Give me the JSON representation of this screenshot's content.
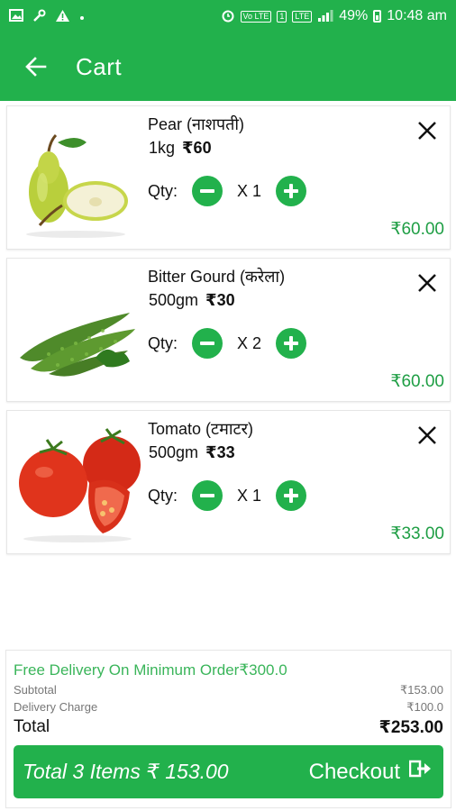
{
  "status_bar": {
    "volte": "Vo LTE",
    "sim": "1",
    "lte": "LTE",
    "battery": "49%",
    "time": "10:48 am"
  },
  "app_bar": {
    "title": "Cart"
  },
  "qty_label": "Qty:",
  "items": [
    {
      "name": "Pear (नाशपती)",
      "unit": "1kg",
      "price": "₹60",
      "qty": "X 1",
      "subtotal": "₹60.00"
    },
    {
      "name": "Bitter Gourd (करेला)",
      "unit": "500gm",
      "price": "₹30",
      "qty": "X 2",
      "subtotal": "₹60.00"
    },
    {
      "name": "Tomato (टमाटर)",
      "unit": "500gm",
      "price": "₹33",
      "qty": "X 1",
      "subtotal": "₹33.00"
    }
  ],
  "summary": {
    "free_delivery": "Free Delivery On Minimum Order₹300.0",
    "subtotal_label": "Subtotal",
    "subtotal_value": "₹153.00",
    "delivery_label": "Delivery Charge",
    "delivery_value": "₹100.0",
    "total_label": "Total",
    "total_value": "₹253.00"
  },
  "checkout_bar": {
    "total_text": "Total 3 Items ₹ 153.00",
    "checkout_label": "Checkout"
  },
  "colors": {
    "primary": "#22b14c",
    "price_green": "#1e9e44",
    "free_delivery": "#3ab55a"
  },
  "icons": [
    "back-arrow-icon",
    "close-icon",
    "minus-icon",
    "plus-icon",
    "logout-arrow-icon"
  ]
}
